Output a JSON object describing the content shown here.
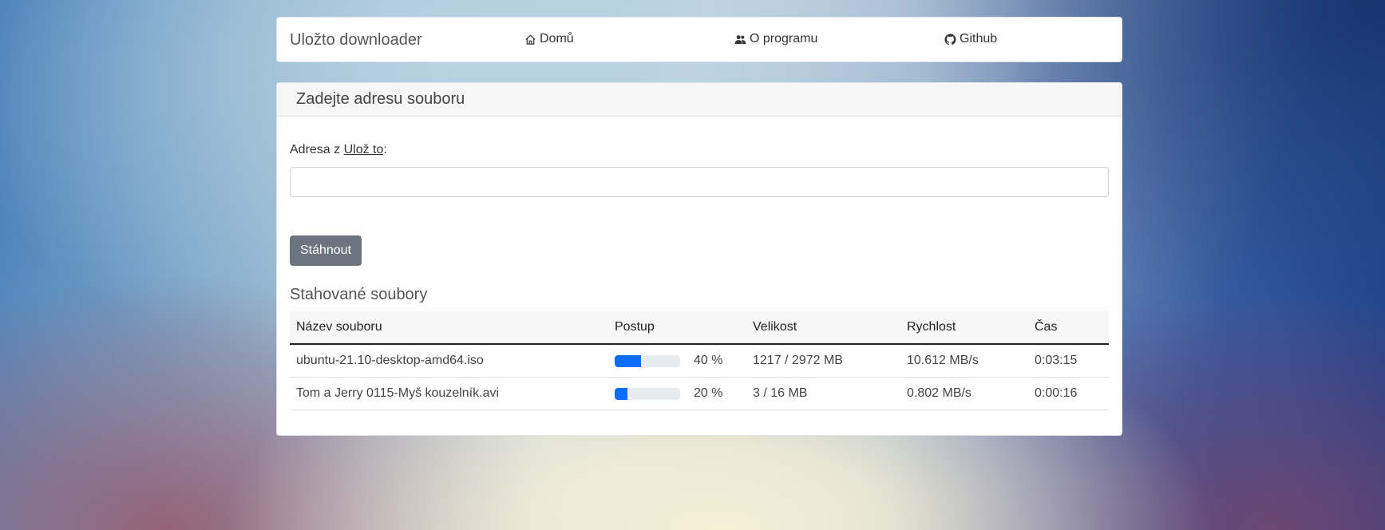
{
  "navbar": {
    "brand": "Uložto downloader",
    "links": [
      {
        "label": "Domů",
        "icon": "home-icon"
      },
      {
        "label": "O programu",
        "icon": "users-icon"
      },
      {
        "label": "Github",
        "icon": "github-icon"
      }
    ]
  },
  "form": {
    "header": "Zadejte adresu souboru",
    "label_prefix": "Adresa z ",
    "label_link": "Ulož to",
    "label_suffix": ":",
    "input_value": "",
    "input_placeholder": "",
    "button_label": "Stáhnout"
  },
  "downloads": {
    "title": "Stahované soubory",
    "columns": [
      "Název souboru",
      "Postup",
      "Velikost",
      "Rychlost",
      "Čas"
    ],
    "rows": [
      {
        "name": "ubuntu-21.10-desktop-amd64.iso",
        "progress": 40,
        "progress_label": "40 %",
        "size": "1217 / 2972 MB",
        "speed": "10.612 MB/s",
        "time": "0:03:15"
      },
      {
        "name": "Tom a Jerry 0115-Myš kouzelník.avi",
        "progress": 20,
        "progress_label": "20 %",
        "size": "3 / 16 MB",
        "speed": "0.802 MB/s",
        "time": "0:00:16"
      }
    ]
  },
  "colors": {
    "accent": "#0d6efd",
    "button": "#6c757d"
  }
}
